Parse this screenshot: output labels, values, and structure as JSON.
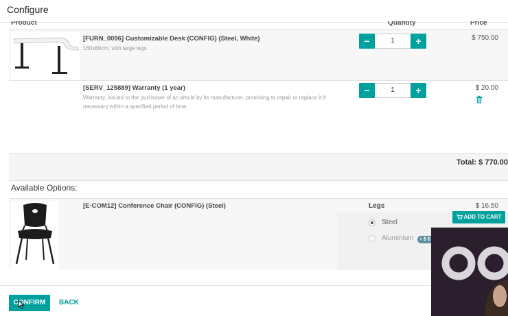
{
  "dialog": {
    "title": "Configure"
  },
  "table": {
    "headers": {
      "product": "Product",
      "quantity": "Quantity",
      "price": "Price"
    },
    "rows": [
      {
        "name": "[FURN_0096] Customizable Desk (CONFIG) (Steel, White)",
        "description": "160x80cm, with large legs.",
        "quantity": "1",
        "price": "$ 750.00"
      },
      {
        "name": "[SERV_125889] Warranty (1 year)",
        "description": "Warranty, issued to the purchaser of an article by its manufacturer, promising to repair or replace it if necessary within a specified period of time.",
        "quantity": "1",
        "price": "$ 20.00"
      }
    ],
    "total": "Total: $ 770.00"
  },
  "options": {
    "title": "Available Options:",
    "items": [
      {
        "name": "[E-COM12] Conference Chair (CONFIG) (Steel)",
        "attribute_label": "Legs",
        "values": [
          {
            "label": "Steel",
            "selected": true
          },
          {
            "label": "Aluminium",
            "selected": false,
            "extra": "+ $ 6"
          }
        ],
        "price": "$ 16.50",
        "add_button": "ADD TO CART"
      }
    ]
  },
  "footer": {
    "confirm": "CONFIRM",
    "back": "BACK"
  },
  "colors": {
    "accent": "#00a09d",
    "badge": "#5a8fa0"
  }
}
